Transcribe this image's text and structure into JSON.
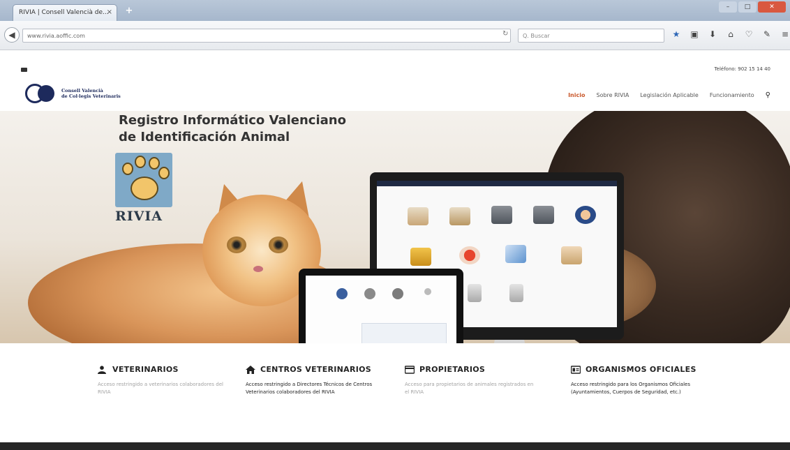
{
  "browser": {
    "tab_title": "RIVIA | Consell Valencià de...",
    "tab_close": "×",
    "new_tab": "+",
    "url": "www.rivia.aoffic.com",
    "search_placeholder": "Q. Buscar",
    "reload": "↻"
  },
  "top": {
    "phone": "Teléfono: 902 15 14 40"
  },
  "logo": {
    "line1": "Consell Valencià",
    "line2": "de Col·legis Veterinaris"
  },
  "nav": {
    "items": [
      "Inicio",
      "Sobre RIVIA",
      "Legislación Aplicable",
      "Funcionamiento"
    ],
    "search_glyph": "🔍"
  },
  "hero": {
    "title_line1": "Registro Informático Valenciano",
    "title_line2": "de Identificación Animal",
    "logo_word": "RIVIA"
  },
  "sections": [
    {
      "title": "VETERINARIOS",
      "icon": "person-icon",
      "desc": "Acceso restringido a veterinarios colaboradores del RIVIA"
    },
    {
      "title": "CENTROS VETERINARIOS",
      "icon": "home-icon",
      "desc": "Acceso restringido a Directores Técnicos de Centros Veterinarios colaboradores del RIVIA"
    },
    {
      "title": "PROPIETARIOS",
      "icon": "card-icon",
      "desc": "Acceso para propietarios de animales registrados en el RIVIA"
    },
    {
      "title": "ORGANISMOS OFICIALES",
      "icon": "id-card-icon",
      "desc": "Acceso restringido para los Organismos Oficiales (Ayuntamientos, Cuerpos de Seguridad, etc.)"
    }
  ],
  "colors": {
    "nav_active": "#c9572a",
    "logo_blue": "#1d2a5c",
    "footer": "#262626"
  }
}
